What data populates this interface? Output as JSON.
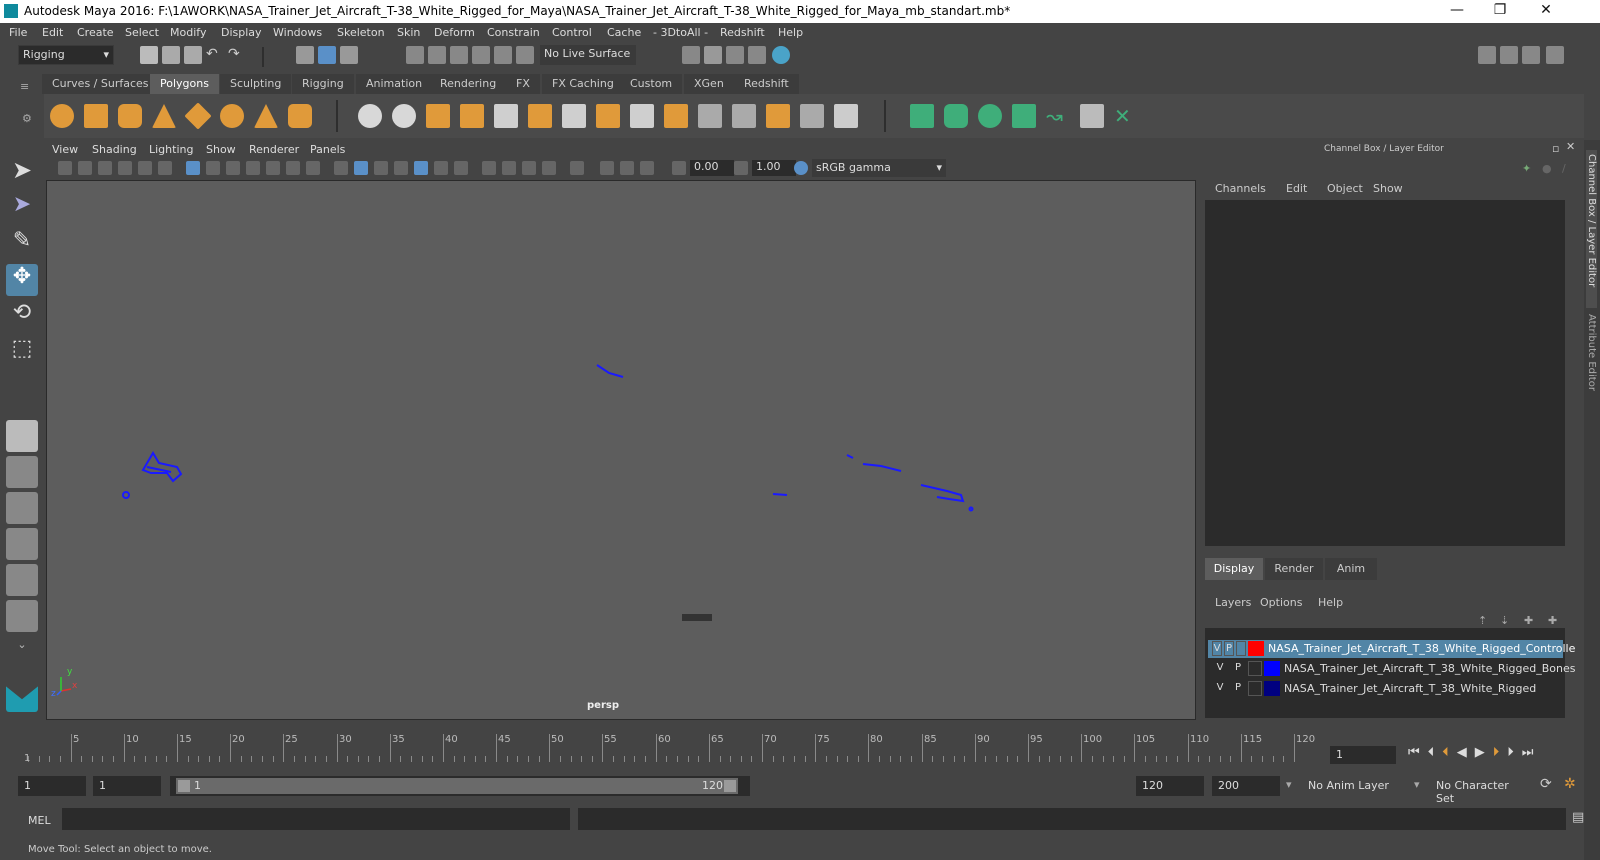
{
  "window": {
    "title": "Autodesk Maya 2016: F:\\1AWORK\\NASA_Trainer_Jet_Aircraft_T-38_White_Rigged_for_Maya\\NASA_Trainer_Jet_Aircraft_T-38_White_Rigged_for_Maya_mb_standart.mb*",
    "minimize": "—",
    "maximize": "❐",
    "close": "✕"
  },
  "menus": [
    "File",
    "Edit",
    "Create",
    "Select",
    "Modify",
    "Display",
    "Windows",
    "Skeleton",
    "Skin",
    "Deform",
    "Constrain",
    "Control",
    "Cache",
    "- 3DtoAll -",
    "Redshift",
    "Help"
  ],
  "status": {
    "menuset": "Rigging",
    "live_surface": "No Live Surface"
  },
  "shelf_tabs": [
    "Curves / Surfaces",
    "Polygons",
    "Sculpting",
    "Rigging",
    "Animation",
    "Rendering",
    "FX",
    "FX Caching",
    "Custom",
    "XGen",
    "Redshift"
  ],
  "shelf_active": "Polygons",
  "viewport": {
    "menus": [
      "View",
      "Shading",
      "Lighting",
      "Show",
      "Renderer",
      "Panels"
    ],
    "exposure": "0.00",
    "gamma": "1.00",
    "color_space": "sRGB gamma",
    "camera_label": "persp",
    "axis_x": "x",
    "axis_y": "y",
    "axis_z": "z"
  },
  "channel_box": {
    "title": "Channel Box / Layer Editor",
    "menus": [
      "Channels",
      "Edit",
      "Object",
      "Show"
    ],
    "layer_tabs": [
      "Display",
      "Render",
      "Anim"
    ],
    "layer_menus": [
      "Layers",
      "Options",
      "Help"
    ],
    "layers": [
      {
        "v": "V",
        "p": "P",
        "color": "#ff0000",
        "name": "NASA_Trainer_Jet_Aircraft_T_38_White_Rigged_Controlle",
        "selected": true
      },
      {
        "v": "V",
        "p": "P",
        "color": "#0000ff",
        "name": "NASA_Trainer_Jet_Aircraft_T_38_White_Rigged_Bones",
        "selected": false
      },
      {
        "v": "V",
        "p": "P",
        "color": "#000080",
        "name": "NASA_Trainer_Jet_Aircraft_T_38_White_Rigged",
        "selected": false
      }
    ]
  },
  "side_tabs": {
    "channel": "Channel Box / Layer Editor",
    "attribute": "Attribute Editor"
  },
  "timeline": {
    "ticks": [
      "5",
      "10",
      "15",
      "20",
      "25",
      "30",
      "35",
      "40",
      "45",
      "50",
      "55",
      "60",
      "65",
      "70",
      "75",
      "80",
      "85",
      "90",
      "95",
      "100",
      "105",
      "110",
      "115",
      "120"
    ],
    "start_label": "1",
    "current_frame": "1"
  },
  "range": {
    "start": "1",
    "playback_start": "1",
    "slider_start": "1",
    "slider_end": "120",
    "playback_end": "120",
    "end": "200",
    "anim_layer": "No Anim Layer",
    "char_set": "No Character Set"
  },
  "command": {
    "lang": "MEL"
  },
  "help_line": "Move Tool: Select an object to move."
}
